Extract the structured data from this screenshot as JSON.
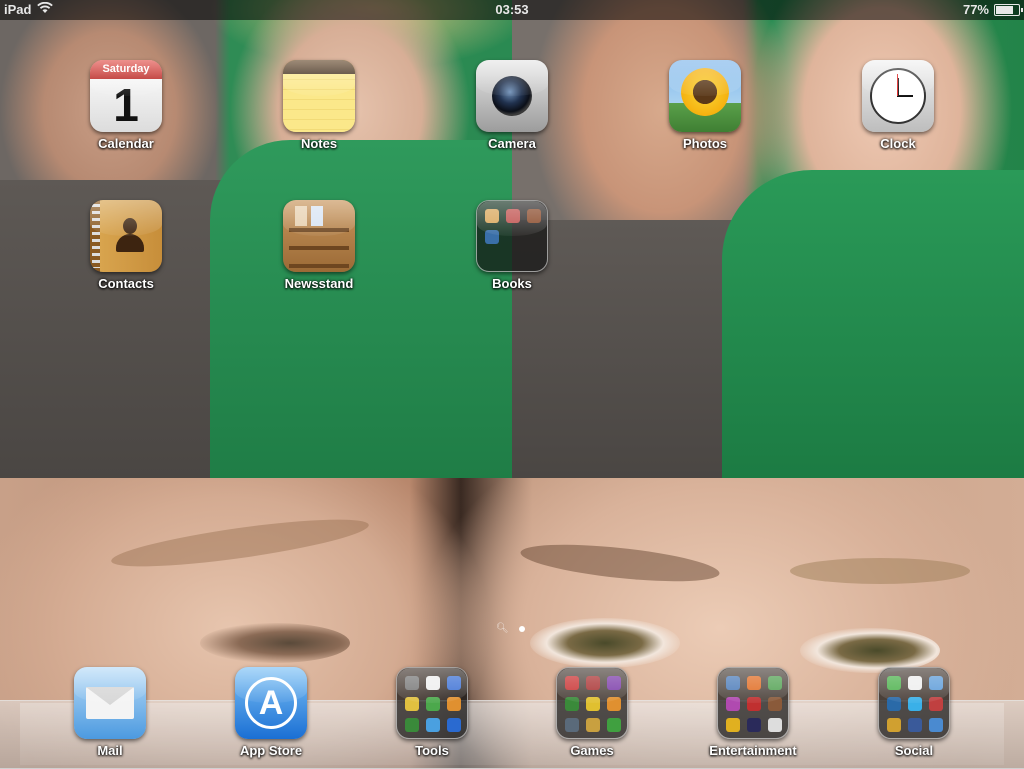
{
  "status_bar": {
    "device": "iPad",
    "time": "03:53",
    "battery": "77%",
    "battery_level": 0.77
  },
  "apps": [
    {
      "label": "Calendar",
      "icon": "calendar-icon",
      "weekday": "Saturday",
      "day": "1"
    },
    {
      "label": "Notes",
      "icon": "notes-icon"
    },
    {
      "label": "Camera",
      "icon": "camera-icon"
    },
    {
      "label": "Photos",
      "icon": "photos-icon"
    },
    {
      "label": "Clock",
      "icon": "clock-icon"
    },
    {
      "label": "Contacts",
      "icon": "contacts-icon"
    },
    {
      "label": "Newsstand",
      "icon": "newsstand-icon"
    },
    {
      "label": "Books",
      "icon": "folder-icon"
    }
  ],
  "dock": [
    {
      "label": "Mail",
      "icon": "mail-icon"
    },
    {
      "label": "App Store",
      "icon": "app-store-icon"
    },
    {
      "label": "Tools",
      "icon": "folder-icon"
    },
    {
      "label": "Games",
      "icon": "folder-icon"
    },
    {
      "label": "Entertainment",
      "icon": "folder-icon"
    },
    {
      "label": "Social",
      "icon": "folder-icon"
    }
  ],
  "page_indicator": {
    "pages": 1,
    "current": 1,
    "has_search_page": true
  },
  "colors": {
    "status_bar_bg": "#000000",
    "label_text": "#ffffff",
    "dock_bg": "#cccccc"
  }
}
